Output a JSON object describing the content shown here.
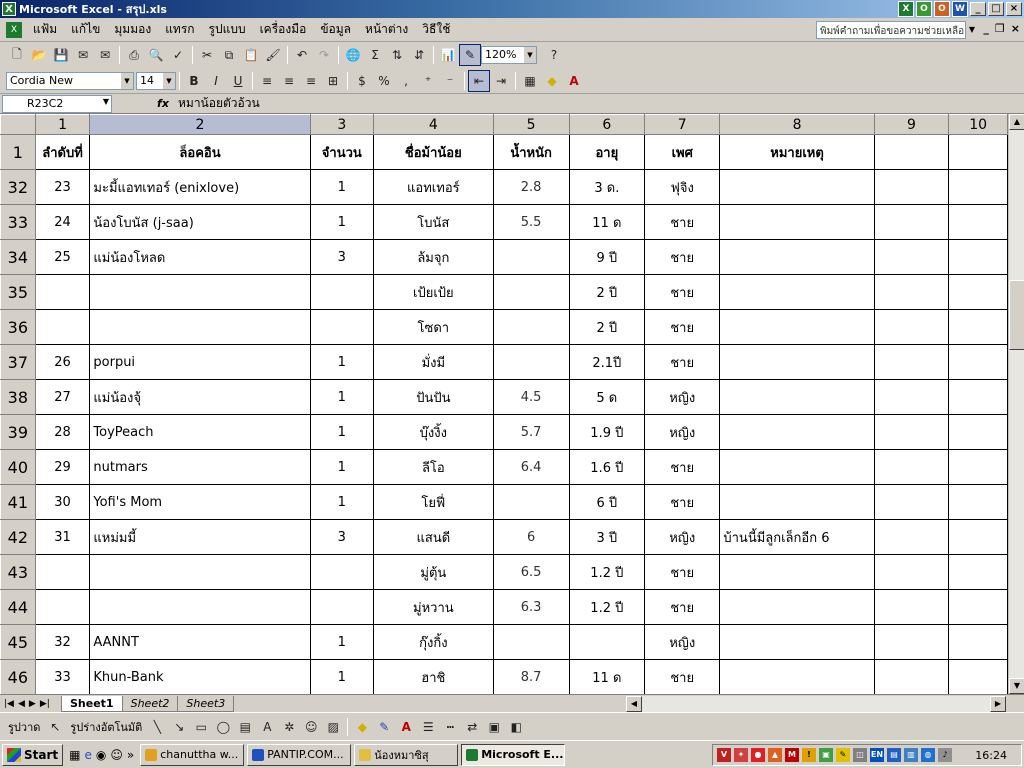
{
  "window": {
    "title": "Microsoft Excel - สรุป.xls",
    "app_icon_letter": "X",
    "tray_apps": [
      "X",
      "O",
      "O",
      "W"
    ],
    "btn_min": "_",
    "btn_max": "□",
    "btn_close": "×"
  },
  "menu": {
    "items": [
      "แฟ้ม",
      "แก้ไข",
      "มุมมอง",
      "แทรก",
      "รูปแบบ",
      "เครื่องมือ",
      "ข้อมูล",
      "หน้าต่าง",
      "วิธีใช้"
    ],
    "ask_placeholder": "พิมพ์คำถามเพื่อขอความช่วยเหลือ",
    "mdi_min": "_",
    "mdi_restore": "❐",
    "mdi_close": "×"
  },
  "standard_toolbar": {
    "zoom": "120%"
  },
  "format_toolbar": {
    "font_name": "Cordia New",
    "font_size": "14",
    "bold": "B",
    "italic": "I",
    "underline": "U"
  },
  "formula_bar": {
    "name_box": "R23C2",
    "fx": "fx",
    "value": "หมาน้อยตัวอ้วน"
  },
  "colors": {
    "title_gradient_start": "#0a246a",
    "excel_green": "#1e7a2e"
  },
  "sheet": {
    "column_headers": [
      "1",
      "2",
      "3",
      "4",
      "5",
      "6",
      "7",
      "8",
      "9",
      "10"
    ],
    "header_row": {
      "row_num": "1",
      "cells": [
        "ลำดับที่",
        "ล็อคอิน",
        "จำนวน",
        "ชื่อม้าน้อย",
        "น้ำหนัก",
        "อายุ",
        "เพศ",
        "หมายเหตุ",
        "",
        ""
      ]
    },
    "rows": [
      {
        "row_num": "32",
        "cells": [
          "23",
          "มะมี้แอทเทอร์ (enixlove)",
          "1",
          "แอทเทอร์",
          "2.8",
          "3 ด.",
          "ฟุจิง",
          "",
          "",
          ""
        ]
      },
      {
        "row_num": "33",
        "cells": [
          "24",
          "น้องโบนัส (j-saa)",
          "1",
          "โบนัส",
          "5.5",
          "11 ด",
          "ชาย",
          "",
          "",
          ""
        ]
      },
      {
        "row_num": "34",
        "cells": [
          "25",
          "แม่น้องโหลด",
          "3",
          "ล้มจุก",
          "",
          "9 ปี",
          "ชาย",
          "",
          "",
          ""
        ]
      },
      {
        "row_num": "35",
        "cells": [
          "",
          "",
          "",
          "เป้ยเป้ย",
          "",
          "2 ปี",
          "ชาย",
          "",
          "",
          ""
        ]
      },
      {
        "row_num": "36",
        "cells": [
          "",
          "",
          "",
          "โซดา",
          "",
          "2 ปี",
          "ชาย",
          "",
          "",
          ""
        ]
      },
      {
        "row_num": "37",
        "cells": [
          "26",
          "porpui",
          "1",
          "มั่งมี",
          "",
          "2.1ปี",
          "ชาย",
          "",
          "",
          ""
        ]
      },
      {
        "row_num": "38",
        "cells": [
          "27",
          "แม่น้องจุ้",
          "1",
          "ปันปัน",
          "4.5",
          "5 ด",
          "หญิง",
          "",
          "",
          ""
        ]
      },
      {
        "row_num": "39",
        "cells": [
          "28",
          "ToyPeach",
          "1",
          "บุ๊งงิ้ง",
          "5.7",
          "1.9 ปี",
          "หญิง",
          "",
          "",
          ""
        ]
      },
      {
        "row_num": "40",
        "cells": [
          "29",
          "nutmars",
          "1",
          "ลีโอ",
          "6.4",
          "1.6 ปี",
          "ชาย",
          "",
          "",
          ""
        ]
      },
      {
        "row_num": "41",
        "cells": [
          "30",
          "Yofi's Mom",
          "1",
          "โยฟี่",
          "",
          "6 ปี",
          "ชาย",
          "",
          "",
          ""
        ]
      },
      {
        "row_num": "42",
        "cells": [
          "31",
          "แหม่มมี้",
          "3",
          "แสนดี",
          "6",
          "3 ปี",
          "หญิง",
          "บ้านนี้มีลูกเล็กอีก 6",
          "",
          ""
        ]
      },
      {
        "row_num": "43",
        "cells": [
          "",
          "",
          "",
          "มู่ตุ้น",
          "6.5",
          "1.2 ปี",
          "ชาย",
          "",
          "",
          ""
        ]
      },
      {
        "row_num": "44",
        "cells": [
          "",
          "",
          "",
          "มู่หวาน",
          "6.3",
          "1.2 ปี",
          "ชาย",
          "",
          "",
          ""
        ]
      },
      {
        "row_num": "45",
        "cells": [
          "32",
          "AANNT",
          "1",
          "กุ๊งกิ้ง",
          "",
          "",
          "หญิง",
          "",
          "",
          ""
        ]
      },
      {
        "row_num": "46",
        "cells": [
          "33",
          "Khun-Bank",
          "1",
          "ฮาชิ",
          "8.7",
          "11 ด",
          "ชาย",
          "",
          "",
          ""
        ]
      }
    ]
  },
  "sheet_tabs": [
    "Sheet1",
    "Sheet2",
    "Sheet3"
  ],
  "drawing_toolbar": {
    "draw_label": "รูปวาด",
    "autoshapes_label": "รูปร่างอัตโนมัติ"
  },
  "taskbar": {
    "start_label": "Start",
    "tasks": [
      {
        "label": "chanuttha w...",
        "color": "#e0a020"
      },
      {
        "label": "PANTIP.COM...",
        "color": "#2050c0"
      },
      {
        "label": "น้องหมาซิสุ",
        "color": "#e0c040"
      },
      {
        "label": "Microsoft E...",
        "color": "#1e7a2e"
      }
    ],
    "active_task": 3,
    "tray_lang": "EN",
    "clock": "16:24"
  }
}
